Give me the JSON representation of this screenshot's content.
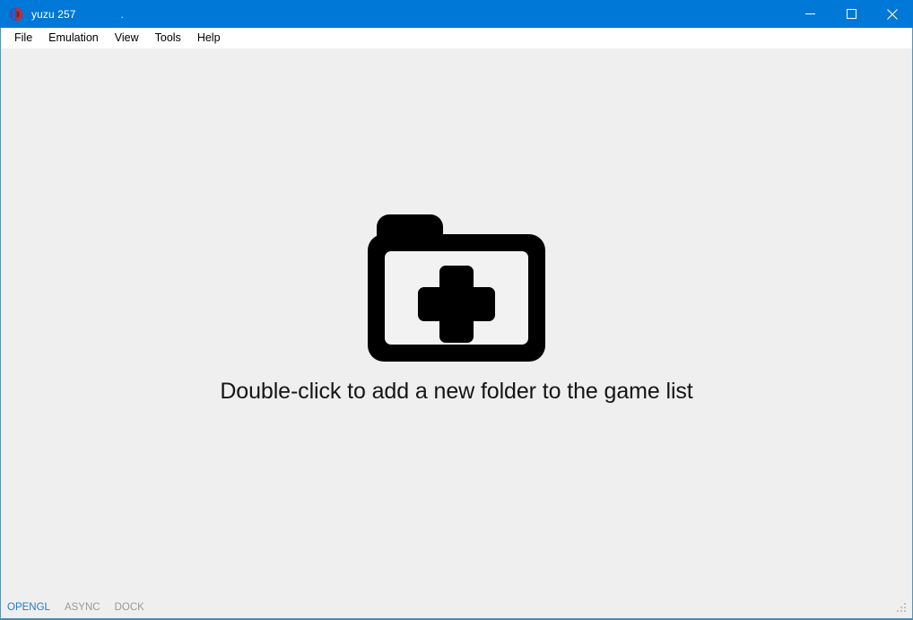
{
  "window": {
    "title": "yuzu 257",
    "title_suffix": ".",
    "icon": "yuzu-logo-icon",
    "accent_color": "#0078d7",
    "border_color": "#5b93b5",
    "content_background": "#efefef"
  },
  "controls": {
    "minimize": "minimize-icon",
    "maximize": "maximize-icon",
    "close": "close-icon"
  },
  "menubar": {
    "items": [
      {
        "label": "File"
      },
      {
        "label": "Emulation"
      },
      {
        "label": "View"
      },
      {
        "label": "Tools"
      },
      {
        "label": "Help"
      }
    ]
  },
  "main": {
    "icon": "folder-plus-icon",
    "message": "Double-click to add a new folder to the game list"
  },
  "statusbar": {
    "items": [
      {
        "label": "OPENGL",
        "state": "active",
        "color": "#1a7ec8"
      },
      {
        "label": "ASYNC",
        "state": "inactive",
        "color": "#9a9a9a"
      },
      {
        "label": "DOCK",
        "state": "inactive",
        "color": "#9a9a9a"
      }
    ],
    "resize_grip": "resize-grip-icon"
  }
}
